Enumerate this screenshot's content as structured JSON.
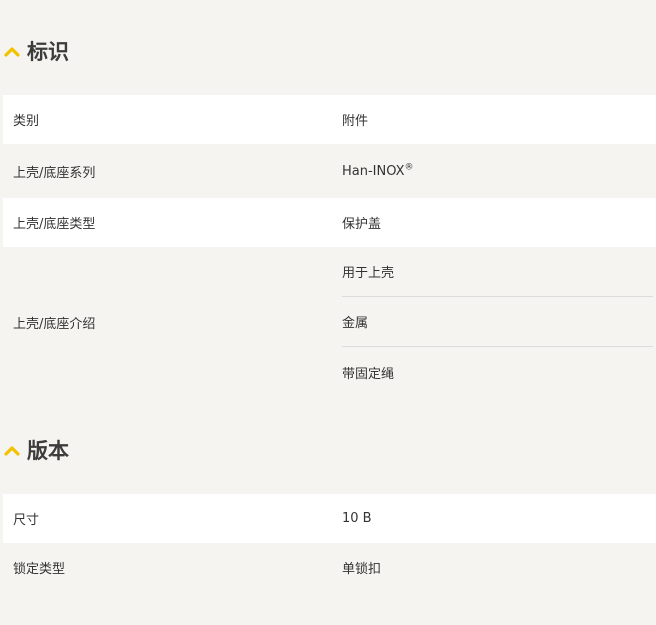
{
  "sections": [
    {
      "title": "标识",
      "rows": [
        {
          "label": "类别",
          "value": "附件"
        },
        {
          "label": "上壳/底座系列",
          "value": "Han-INOX",
          "value_sup": "®"
        },
        {
          "label": "上壳/底座类型",
          "value": "保护盖"
        },
        {
          "label": "上壳/底座介绍",
          "values": [
            "用于上壳",
            "金属",
            "带固定绳"
          ]
        }
      ]
    },
    {
      "title": "版本",
      "rows": [
        {
          "label": "尺寸",
          "value": "10 B"
        },
        {
          "label": "锁定类型",
          "value": "单锁扣"
        }
      ]
    }
  ],
  "colors": {
    "accent": "#f2c200",
    "row_white": "#ffffff",
    "row_grey": "#f5f4f1",
    "divider": "#dcdcdc"
  }
}
